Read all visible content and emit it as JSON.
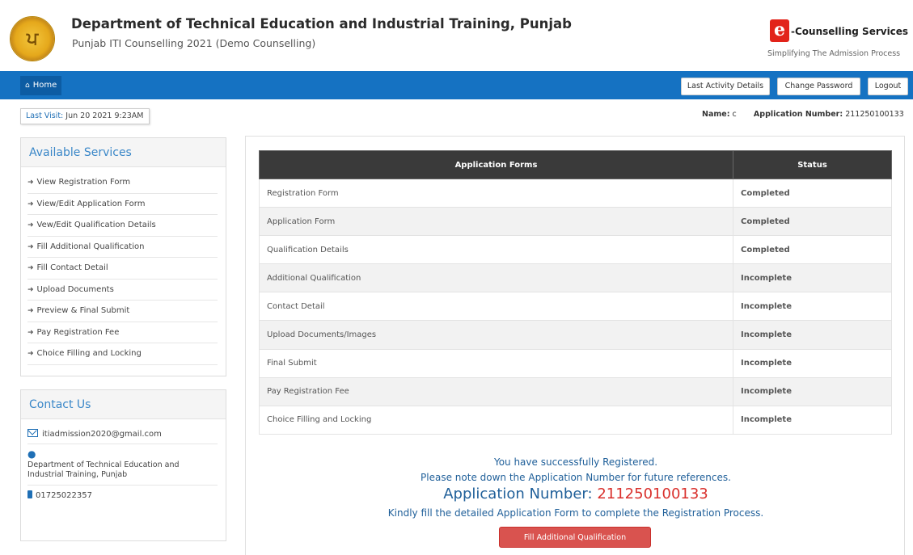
{
  "header": {
    "department_title": "Department of Technical Education and Industrial Training, Punjab",
    "subtitle": "Punjab ITI Counselling 2021 (Demo Counselling)",
    "brand_letter": "e",
    "brand_name": "-Counselling Services",
    "brand_tagline": "Simplifying The Admission Process"
  },
  "nav": {
    "home_icon": "home-icon",
    "home_label": "Home",
    "last_activity_label": "Last Activity Details",
    "change_password_label": "Change Password",
    "logout_label": "Logout"
  },
  "info": {
    "last_visit_label": "Last Visit:",
    "last_visit_value": "Jun 20 2021 9:23AM",
    "name_label": "Name:",
    "name_value": "c",
    "app_number_label": "Application Number:",
    "app_number_value": "211250100133"
  },
  "sidebar": {
    "services_title": "Available Services",
    "services": [
      "View Registration Form",
      "View/Edit Application Form",
      "Vew/Edit Qualification Details",
      "Fill Additional Qualification",
      "Fill Contact Detail",
      "Upload Documents",
      "Preview & Final Submit",
      "Pay Registration Fee",
      "Choice Filling and Locking"
    ],
    "contact_title": "Contact Us",
    "contact_email": "itiadmission2020@gmail.com",
    "contact_address": "Department of Technical Education and Industrial Training, Punjab",
    "contact_phone": "01725022357"
  },
  "forms_table": {
    "headers": [
      "Application Forms",
      "Status"
    ],
    "rows": [
      {
        "form": "Registration Form",
        "status": "Completed"
      },
      {
        "form": "Application Form",
        "status": "Completed"
      },
      {
        "form": "Qualification Details",
        "status": "Completed"
      },
      {
        "form": "Additional Qualification",
        "status": "Incomplete"
      },
      {
        "form": "Contact Detail",
        "status": "Incomplete"
      },
      {
        "form": "Upload Documents/Images",
        "status": "Incomplete"
      },
      {
        "form": "Final Submit",
        "status": "Incomplete"
      },
      {
        "form": "Pay Registration Fee",
        "status": "Incomplete"
      },
      {
        "form": "Choice Filling and Locking",
        "status": "Incomplete"
      }
    ]
  },
  "message": {
    "line1": "You have successfully Registered.",
    "line2": "Please note down the Application Number for future references.",
    "app_number_label": "Application Number:",
    "app_number_value": "211250100133",
    "line3": "Kindly fill the detailed Application Form to complete the Registration Process.",
    "button_label": "Fill Additional Qualification"
  },
  "colors": {
    "nav_blue": "#1572c2",
    "completed": "#2e8b2e",
    "incomplete": "#d9302c",
    "accent_button": "#d9534f"
  }
}
